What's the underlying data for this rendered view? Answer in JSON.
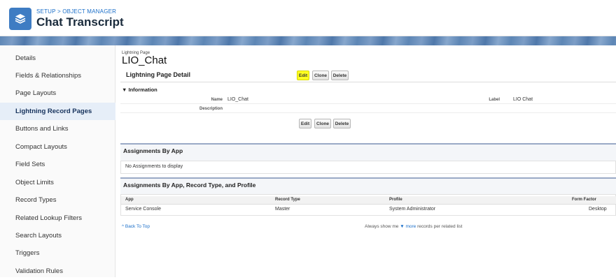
{
  "header": {
    "breadcrumb": "SETUP > OBJECT MANAGER",
    "title": "Chat Transcript",
    "icon": "layers-icon"
  },
  "sidebar": {
    "items": [
      {
        "label": "Details"
      },
      {
        "label": "Fields & Relationships"
      },
      {
        "label": "Page Layouts"
      },
      {
        "label": "Lightning Record Pages",
        "active": true
      },
      {
        "label": "Buttons and Links"
      },
      {
        "label": "Compact Layouts"
      },
      {
        "label": "Field Sets"
      },
      {
        "label": "Object Limits"
      },
      {
        "label": "Record Types"
      },
      {
        "label": "Related Lookup Filters"
      },
      {
        "label": "Search Layouts"
      },
      {
        "label": "Triggers"
      },
      {
        "label": "Validation Rules"
      }
    ]
  },
  "page": {
    "type_label": "Lightning Page",
    "name": "LIO_Chat"
  },
  "detail": {
    "title": "Lightning Page Detail",
    "buttons": {
      "edit": "Edit",
      "clone": "Clone",
      "delete": "Delete"
    }
  },
  "information": {
    "header": "▼ Information",
    "name_label": "Name",
    "name_value": "LIO_Chat",
    "label_label": "Label",
    "label_value": "LIO Chat",
    "description_label": "Description",
    "description_value": ""
  },
  "assignments_by_app": {
    "title": "Assignments By App",
    "empty_text": "No Assignments to display"
  },
  "assignments_by_profile": {
    "title": "Assignments By App, Record Type, and Profile",
    "columns": [
      "App",
      "Record Type",
      "Profile",
      "Form Factor"
    ],
    "rows": [
      [
        "Service Console",
        "Master",
        "System Administrator",
        "Desktop"
      ]
    ]
  },
  "footer": {
    "back_to_top": "^ Back To Top",
    "always_show_prefix": "Always show me",
    "more_link": "▼ more",
    "always_show_suffix": "records per related list"
  },
  "colors": {
    "accent": "#1b6fc9",
    "highlight": "#ffff22",
    "icon_bg": "#3e7cc3"
  }
}
